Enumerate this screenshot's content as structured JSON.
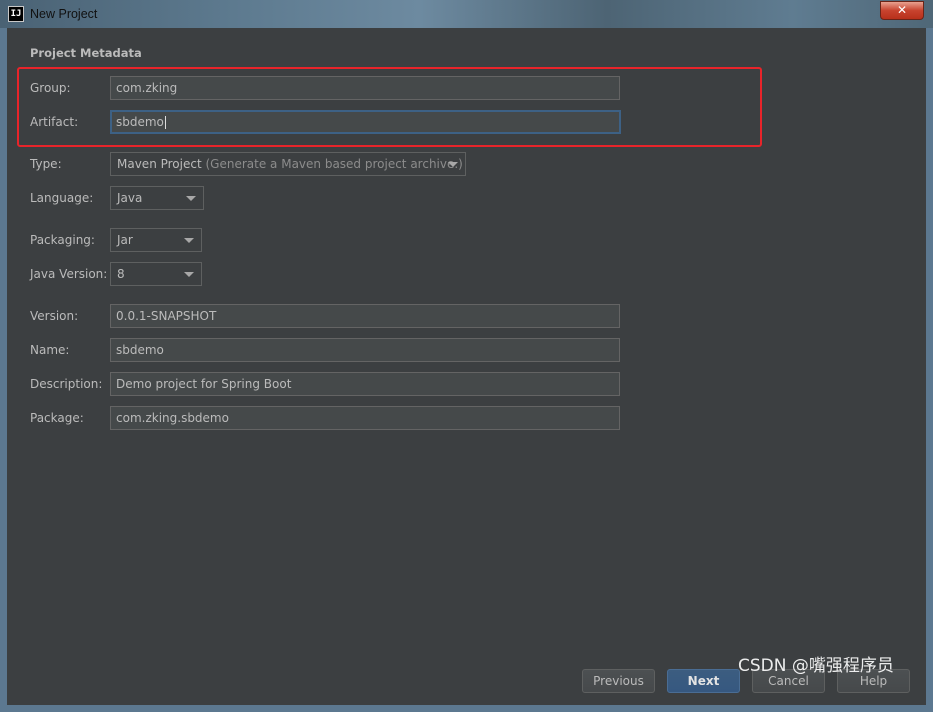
{
  "window": {
    "title": "New Project",
    "app_icon_text": "IJ",
    "close_label": "✕"
  },
  "section_title": "Project Metadata",
  "form": {
    "group": {
      "label": "Group:",
      "value": "com.zking"
    },
    "artifact": {
      "label": "Artifact:",
      "value": "sbdemo"
    },
    "type": {
      "label": "Type:",
      "value": "Maven Project",
      "hint": "(Generate a Maven based project archive.)"
    },
    "language": {
      "label": "Language:",
      "value": "Java"
    },
    "packaging": {
      "label": "Packaging:",
      "value": "Jar"
    },
    "java_version": {
      "label": "Java Version:",
      "value": "8"
    },
    "version": {
      "label": "Version:",
      "value": "0.0.1-SNAPSHOT"
    },
    "name": {
      "label": "Name:",
      "value": "sbdemo"
    },
    "description": {
      "label": "Description:",
      "value": "Demo project for Spring Boot"
    },
    "package": {
      "label": "Package:",
      "value": "com.zking.sbdemo"
    }
  },
  "buttons": {
    "previous": "Previous",
    "next": "Next",
    "cancel": "Cancel",
    "help": "Help"
  },
  "watermark": "CSDN @嘴强程序员",
  "colors": {
    "background": "#3c3f41",
    "field_background": "#45494a",
    "focus_border": "#3d6185",
    "highlight_box": "#e8242a",
    "primary_button": "#365880"
  }
}
